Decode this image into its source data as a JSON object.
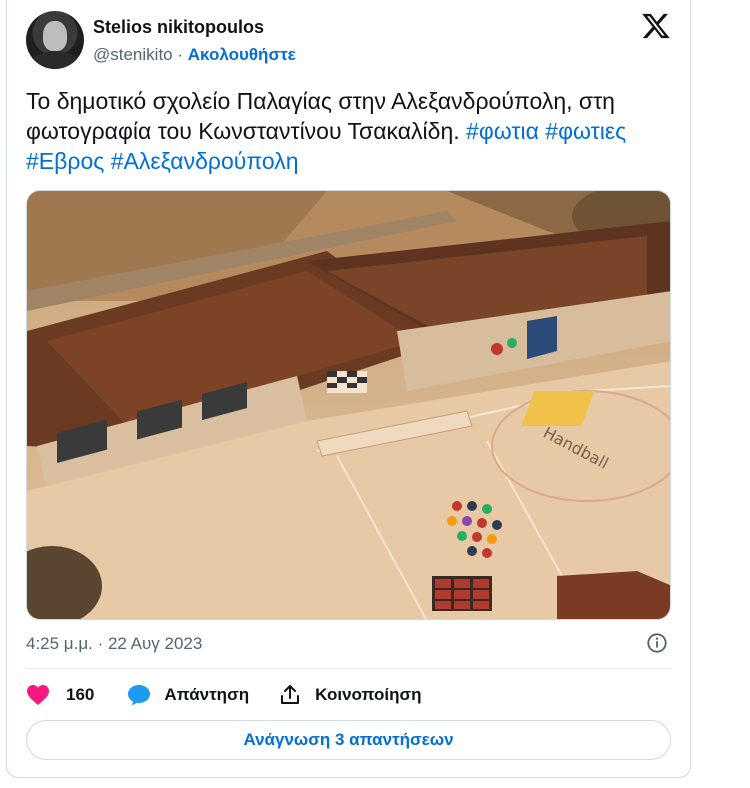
{
  "author": {
    "display_name": "Stelios nikitopoulos",
    "handle": "@stenikito",
    "separator": "·",
    "follow_label": "Ακολουθήστε"
  },
  "tweet": {
    "text": "Το δημοτικό σχολείο Παλαγίας στην Αλεξανδρούπολη, στη φωτογραφία του Κωνσταντίνου Τσακαλίδη.",
    "hashtags": [
      "#φωτια",
      "#φωτιες",
      "#Εβρος",
      "#Αλεξανδρούπολη"
    ],
    "image_text": "Handball"
  },
  "meta": {
    "timestamp": "4:25 μ.μ. · 22 Αυγ 2023"
  },
  "actions": {
    "likes_count": "160",
    "reply_label": "Απάντηση",
    "share_label": "Κοινοποίηση"
  },
  "read_replies_label": "Ανάγνωση 3 απαντήσεων",
  "colors": {
    "accent": "#006fd6",
    "like": "#f91880",
    "reply": "#1d9bf0",
    "muted": "#536471"
  },
  "icons": [
    "x-logo-icon",
    "info-icon",
    "heart-icon",
    "reply-bubble-icon",
    "share-icon"
  ]
}
